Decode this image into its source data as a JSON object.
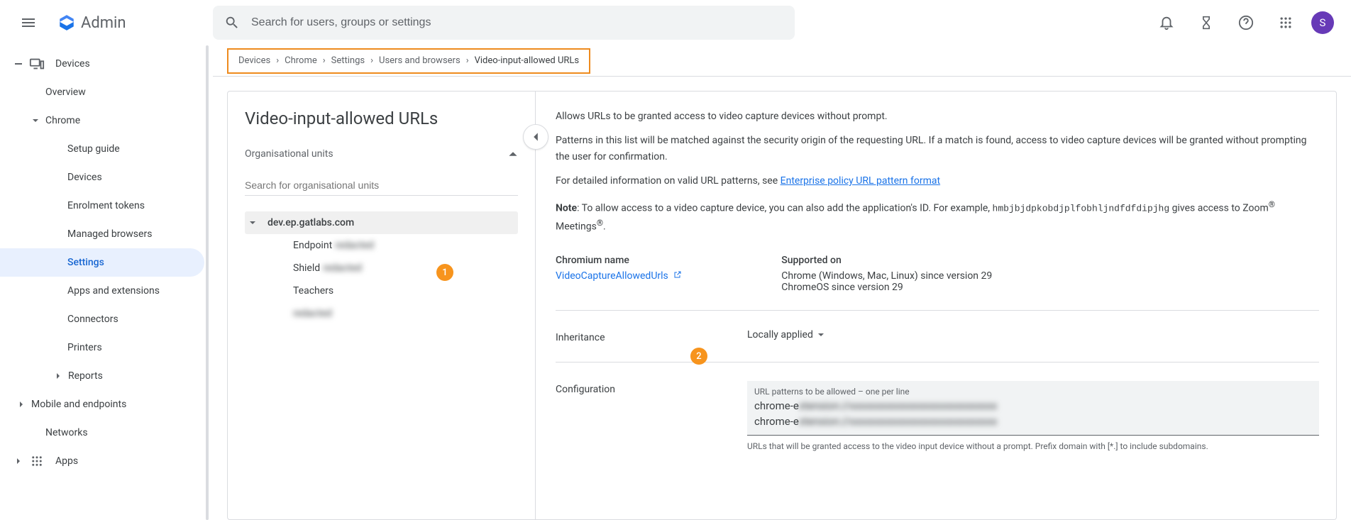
{
  "header": {
    "app_name": "Admin",
    "search_placeholder": "Search for users, groups or settings",
    "avatar_letter": "S"
  },
  "sidebar": {
    "items": [
      {
        "label": "Devices",
        "icon": "devices",
        "caret": "collapse"
      },
      {
        "label": "Overview",
        "indent": 1
      },
      {
        "label": "Chrome",
        "caret": "down",
        "indent": 1
      },
      {
        "label": "Setup guide",
        "indent": 2
      },
      {
        "label": "Devices",
        "indent": 2
      },
      {
        "label": "Enrolment tokens",
        "indent": 2
      },
      {
        "label": "Managed browsers",
        "indent": 2
      },
      {
        "label": "Settings",
        "indent": 2,
        "selected": true
      },
      {
        "label": "Apps and extensions",
        "indent": 2
      },
      {
        "label": "Connectors",
        "indent": 2
      },
      {
        "label": "Printers",
        "indent": 2
      },
      {
        "label": "Reports",
        "caret": "right",
        "indent": 2
      },
      {
        "label": "Mobile and endpoints",
        "caret": "right",
        "indent": 0
      },
      {
        "label": "Networks",
        "indent": 1
      },
      {
        "label": "Apps",
        "caret": "right",
        "icon": "apps",
        "indent": -1
      }
    ]
  },
  "breadcrumbs": [
    "Devices",
    "Chrome",
    "Settings",
    "Users and browsers",
    "Video-input-allowed URLs"
  ],
  "left_panel": {
    "title": "Video-input-allowed URLs",
    "ou_header": "Organisational units",
    "ou_search_placeholder": "Search for organisational units",
    "ou_tree": [
      {
        "label": "dev.ep.gatlabs.com",
        "caret": true,
        "selected": true
      },
      {
        "label": "Endpoint",
        "child": true,
        "blurred_suffix": "redacted"
      },
      {
        "label": "Shield",
        "child": true,
        "blurred_suffix": "redacted"
      },
      {
        "label": "Teachers",
        "child": true
      },
      {
        "label": "",
        "child": true,
        "blurred_suffix": "redacted"
      }
    ]
  },
  "right_panel": {
    "intro1": "Allows URLs to be granted access to video capture devices without prompt.",
    "intro2": "Patterns in this list will be matched against the security origin of the requesting URL. If a match is found, access to video capture devices will be granted without prompting the user for confirmation.",
    "detail_prefix": "For detailed information on valid URL patterns, see ",
    "detail_link": "Enterprise policy URL pattern format",
    "note_label": "Note",
    "note_text": ": To allow access to a video capture device, you can also add the application's ID. For example, ",
    "note_code": "hmbjbjdpkobdjplfobhljndfdfdipjhg",
    "note_tail_a": " gives access to Zoom",
    "note_tail_b": " Meetings",
    "note_tail_c": ".",
    "chromium_label": "Chromium name",
    "chromium_value": "VideoCaptureAllowedUrls",
    "supported_label": "Supported on",
    "supported_lines": [
      "Chrome (Windows, Mac, Linux) since version 29",
      "ChromeOS since version 29"
    ],
    "inheritance_label": "Inheritance",
    "inheritance_value": "Locally applied",
    "config_label": "Configuration",
    "config_placeholder": "URL patterns to be allowed – one per line",
    "config_lines": [
      {
        "prefix": "chrome-e",
        "blur": "xtension://xxxxxxxxxxxxxxxxxxxxxxxxxxxx"
      },
      {
        "prefix": "chrome-e",
        "blur": "xtension://xxxxxxxxxxxxxxxxxxxxxxxxxxxx"
      }
    ],
    "config_help": "URLs that will be granted access to the video input device without a prompt. Prefix domain with [*.] to include subdomains."
  },
  "callouts": {
    "one": "1",
    "two": "2"
  }
}
